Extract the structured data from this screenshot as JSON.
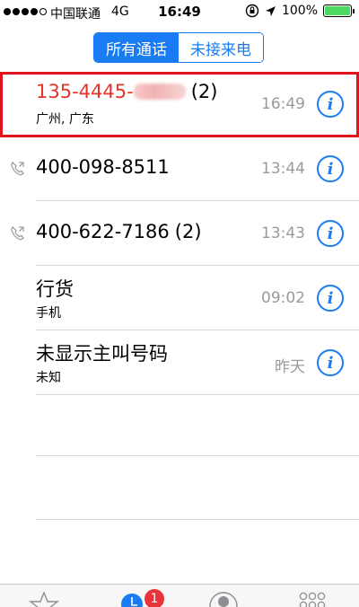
{
  "status_bar": {
    "carrier": "中国联通",
    "network": "4G",
    "time": "16:49",
    "battery": "100%"
  },
  "segments": [
    {
      "label": "所有通话",
      "active": true
    },
    {
      "label": "未接来电",
      "active": false
    }
  ],
  "calls": [
    {
      "number": "135-4445-",
      "count": "(2)",
      "location": "广州, 广东",
      "time": "16:49",
      "missed": true,
      "outgoing": false
    },
    {
      "number": "400-098-8511",
      "count": "",
      "location": "",
      "time": "13:44",
      "missed": false,
      "outgoing": true
    },
    {
      "number": "400-622-7186",
      "count": "(2)",
      "location": "",
      "time": "13:43",
      "missed": false,
      "outgoing": true
    },
    {
      "number": "行货",
      "count": "",
      "location": "手机",
      "time": "09:02",
      "missed": false,
      "outgoing": false
    },
    {
      "number": "未显示主叫号码",
      "count": "",
      "location": "未知",
      "time": "昨天",
      "missed": false,
      "outgoing": false
    }
  ],
  "info_icon": "i",
  "tab_bar": {
    "items": [
      "favorites-icon",
      "recents-icon",
      "contacts-icon",
      "keypad-icon"
    ],
    "badge": "1"
  },
  "colors": {
    "accent": "#1a7cf3",
    "missed": "#e5342a",
    "highlight": "#e0141c",
    "badge": "#e8333a"
  }
}
